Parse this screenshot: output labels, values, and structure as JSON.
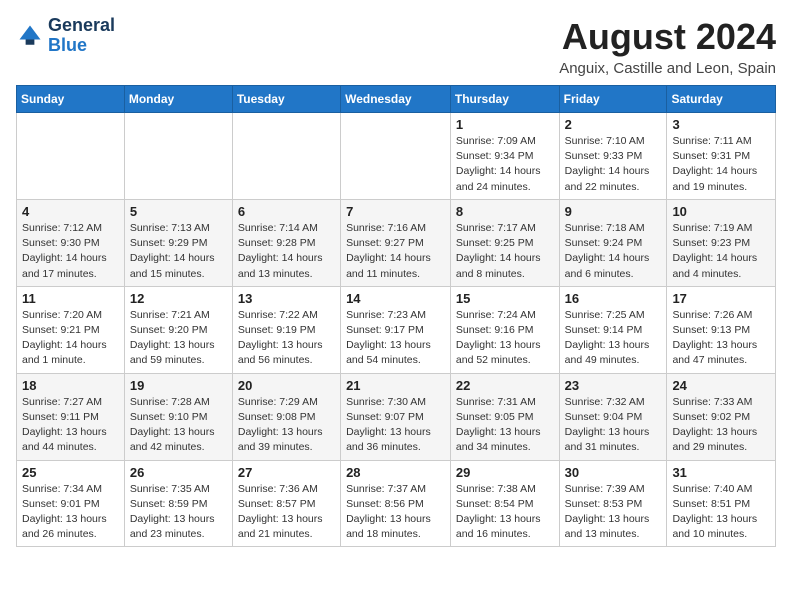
{
  "header": {
    "logo_line1": "General",
    "logo_line2": "Blue",
    "month": "August 2024",
    "location": "Anguix, Castille and Leon, Spain"
  },
  "weekdays": [
    "Sunday",
    "Monday",
    "Tuesday",
    "Wednesday",
    "Thursday",
    "Friday",
    "Saturday"
  ],
  "weeks": [
    [
      {
        "day": "",
        "info": ""
      },
      {
        "day": "",
        "info": ""
      },
      {
        "day": "",
        "info": ""
      },
      {
        "day": "",
        "info": ""
      },
      {
        "day": "1",
        "info": "Sunrise: 7:09 AM\nSunset: 9:34 PM\nDaylight: 14 hours and 24 minutes."
      },
      {
        "day": "2",
        "info": "Sunrise: 7:10 AM\nSunset: 9:33 PM\nDaylight: 14 hours and 22 minutes."
      },
      {
        "day": "3",
        "info": "Sunrise: 7:11 AM\nSunset: 9:31 PM\nDaylight: 14 hours and 19 minutes."
      }
    ],
    [
      {
        "day": "4",
        "info": "Sunrise: 7:12 AM\nSunset: 9:30 PM\nDaylight: 14 hours and 17 minutes."
      },
      {
        "day": "5",
        "info": "Sunrise: 7:13 AM\nSunset: 9:29 PM\nDaylight: 14 hours and 15 minutes."
      },
      {
        "day": "6",
        "info": "Sunrise: 7:14 AM\nSunset: 9:28 PM\nDaylight: 14 hours and 13 minutes."
      },
      {
        "day": "7",
        "info": "Sunrise: 7:16 AM\nSunset: 9:27 PM\nDaylight: 14 hours and 11 minutes."
      },
      {
        "day": "8",
        "info": "Sunrise: 7:17 AM\nSunset: 9:25 PM\nDaylight: 14 hours and 8 minutes."
      },
      {
        "day": "9",
        "info": "Sunrise: 7:18 AM\nSunset: 9:24 PM\nDaylight: 14 hours and 6 minutes."
      },
      {
        "day": "10",
        "info": "Sunrise: 7:19 AM\nSunset: 9:23 PM\nDaylight: 14 hours and 4 minutes."
      }
    ],
    [
      {
        "day": "11",
        "info": "Sunrise: 7:20 AM\nSunset: 9:21 PM\nDaylight: 14 hours and 1 minute."
      },
      {
        "day": "12",
        "info": "Sunrise: 7:21 AM\nSunset: 9:20 PM\nDaylight: 13 hours and 59 minutes."
      },
      {
        "day": "13",
        "info": "Sunrise: 7:22 AM\nSunset: 9:19 PM\nDaylight: 13 hours and 56 minutes."
      },
      {
        "day": "14",
        "info": "Sunrise: 7:23 AM\nSunset: 9:17 PM\nDaylight: 13 hours and 54 minutes."
      },
      {
        "day": "15",
        "info": "Sunrise: 7:24 AM\nSunset: 9:16 PM\nDaylight: 13 hours and 52 minutes."
      },
      {
        "day": "16",
        "info": "Sunrise: 7:25 AM\nSunset: 9:14 PM\nDaylight: 13 hours and 49 minutes."
      },
      {
        "day": "17",
        "info": "Sunrise: 7:26 AM\nSunset: 9:13 PM\nDaylight: 13 hours and 47 minutes."
      }
    ],
    [
      {
        "day": "18",
        "info": "Sunrise: 7:27 AM\nSunset: 9:11 PM\nDaylight: 13 hours and 44 minutes."
      },
      {
        "day": "19",
        "info": "Sunrise: 7:28 AM\nSunset: 9:10 PM\nDaylight: 13 hours and 42 minutes."
      },
      {
        "day": "20",
        "info": "Sunrise: 7:29 AM\nSunset: 9:08 PM\nDaylight: 13 hours and 39 minutes."
      },
      {
        "day": "21",
        "info": "Sunrise: 7:30 AM\nSunset: 9:07 PM\nDaylight: 13 hours and 36 minutes."
      },
      {
        "day": "22",
        "info": "Sunrise: 7:31 AM\nSunset: 9:05 PM\nDaylight: 13 hours and 34 minutes."
      },
      {
        "day": "23",
        "info": "Sunrise: 7:32 AM\nSunset: 9:04 PM\nDaylight: 13 hours and 31 minutes."
      },
      {
        "day": "24",
        "info": "Sunrise: 7:33 AM\nSunset: 9:02 PM\nDaylight: 13 hours and 29 minutes."
      }
    ],
    [
      {
        "day": "25",
        "info": "Sunrise: 7:34 AM\nSunset: 9:01 PM\nDaylight: 13 hours and 26 minutes."
      },
      {
        "day": "26",
        "info": "Sunrise: 7:35 AM\nSunset: 8:59 PM\nDaylight: 13 hours and 23 minutes."
      },
      {
        "day": "27",
        "info": "Sunrise: 7:36 AM\nSunset: 8:57 PM\nDaylight: 13 hours and 21 minutes."
      },
      {
        "day": "28",
        "info": "Sunrise: 7:37 AM\nSunset: 8:56 PM\nDaylight: 13 hours and 18 minutes."
      },
      {
        "day": "29",
        "info": "Sunrise: 7:38 AM\nSunset: 8:54 PM\nDaylight: 13 hours and 16 minutes."
      },
      {
        "day": "30",
        "info": "Sunrise: 7:39 AM\nSunset: 8:53 PM\nDaylight: 13 hours and 13 minutes."
      },
      {
        "day": "31",
        "info": "Sunrise: 7:40 AM\nSunset: 8:51 PM\nDaylight: 13 hours and 10 minutes."
      }
    ]
  ]
}
